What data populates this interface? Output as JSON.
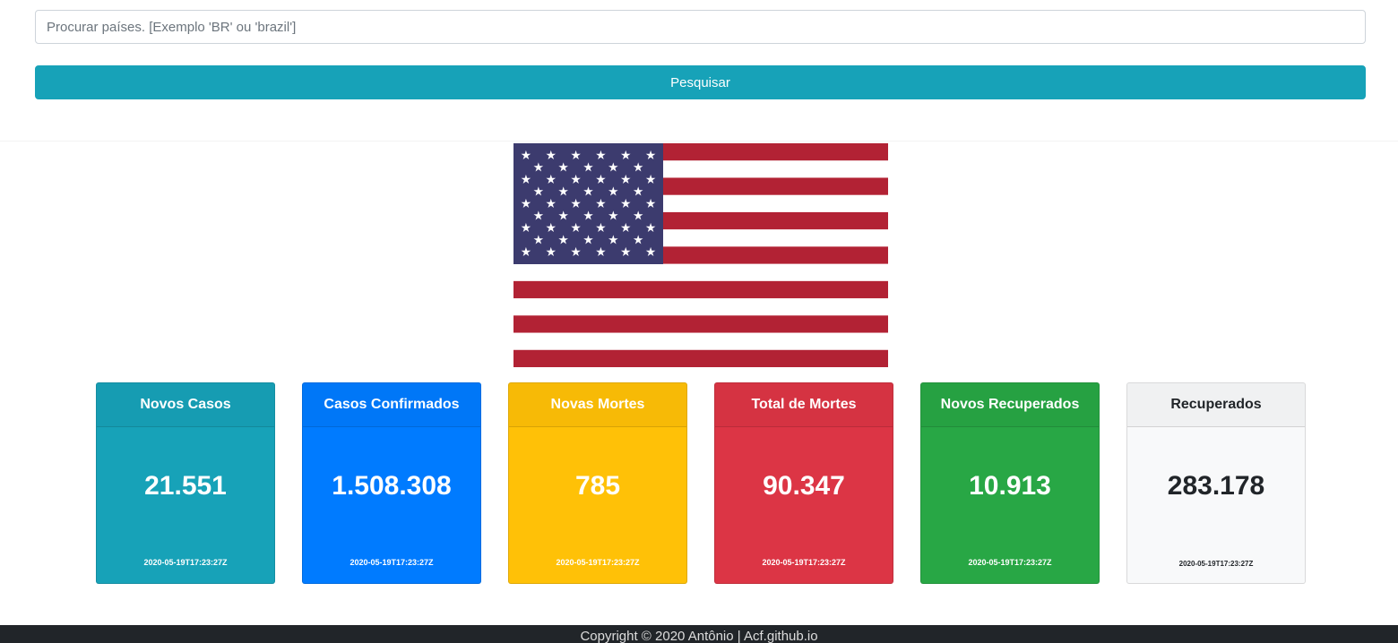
{
  "search": {
    "placeholder": "Procurar países. [Exemplo 'BR' ou 'brazil']",
    "button_label": "Pesquisar"
  },
  "flag": {
    "country": "United States"
  },
  "cards": [
    {
      "title": "Novos Casos",
      "value": "21.551",
      "date": "2020-05-19T17:23:27Z",
      "color": "#17a2b8"
    },
    {
      "title": "Casos Confirmados",
      "value": "1.508.308",
      "date": "2020-05-19T17:23:27Z",
      "color": "#007bff"
    },
    {
      "title": "Novas Mortes",
      "value": "785",
      "date": "2020-05-19T17:23:27Z",
      "color": "#ffc107"
    },
    {
      "title": "Total de Mortes",
      "value": "90.347",
      "date": "2020-05-19T17:23:27Z",
      "color": "#dc3545"
    },
    {
      "title": "Novos Recuperados",
      "value": "10.913",
      "date": "2020-05-19T17:23:27Z",
      "color": "#28a745"
    },
    {
      "title": "Recuperados",
      "value": "283.178",
      "date": "2020-05-19T17:23:27Z",
      "color": "#f8f9fa"
    }
  ],
  "footer": {
    "text": "Copyright © 2020 Antônio | Acf.github.io"
  }
}
